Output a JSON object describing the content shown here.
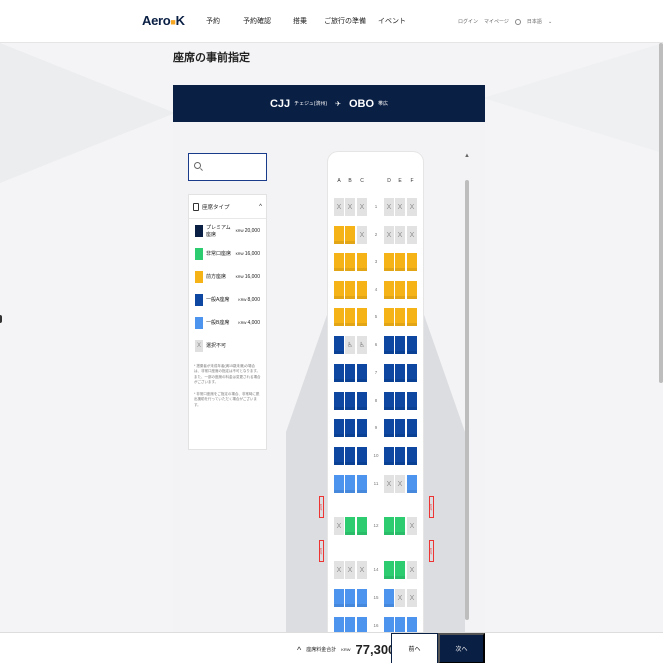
{
  "brand": {
    "logo": "Aero",
    "logo_mark": "■",
    "logo_tail": "K"
  },
  "nav": [
    "予約",
    "予約確認",
    "搭乗",
    "ご旅行の準備",
    "イベント"
  ],
  "header_right": {
    "login": "ログイン",
    "mypage": "マイページ",
    "lang": "日本語"
  },
  "page_title": "座席の事前指定",
  "route": {
    "from_code": "CJJ",
    "from_city": "チェジュ(済州)",
    "to_code": "OBO",
    "to_city": "帯広"
  },
  "search": {
    "placeholder": ""
  },
  "legend": {
    "title": "座席タイプ",
    "items": [
      {
        "label": "プレミアム座席",
        "currency": "KRW",
        "price": "20,000",
        "color": "#0a1f44"
      },
      {
        "label": "非常口座席",
        "currency": "KRW",
        "price": "16,000",
        "color": "#2ecc71"
      },
      {
        "label": "前方座席",
        "currency": "KRW",
        "price": "16,000",
        "color": "#f5b317"
      },
      {
        "label": "一般A座席",
        "currency": "KRW",
        "price": "8,000",
        "color": "#0d47a1"
      },
      {
        "label": "一般B座席",
        "currency": "KRW",
        "price": "4,000",
        "color": "#4c94ee"
      }
    ],
    "na_label": "選択不可",
    "na_mark": "X",
    "note1": "* 搭乗者が未成年者(満15歳未満)の場合は、非常口座席の指定は不可となります。また、一部の座席の料金は変更される場合がございます。",
    "note2": "* 非常口座席をご指定の場合、非常時に脱出援助を行っていただく場合がございます。"
  },
  "seatmap": {
    "columns": [
      "A",
      "B",
      "C",
      "D",
      "E",
      "F"
    ],
    "rows": [
      {
        "num": "1",
        "seats": [
          "na",
          "na",
          "na",
          "na",
          "na",
          "na"
        ]
      },
      {
        "num": "2",
        "seats": [
          "fwd",
          "fwd",
          "na",
          "na",
          "na",
          "na"
        ]
      },
      {
        "num": "3",
        "seats": [
          "fwd",
          "fwd",
          "fwd",
          "fwd",
          "fwd",
          "fwd"
        ]
      },
      {
        "num": "4",
        "seats": [
          "fwd",
          "fwd",
          "fwd",
          "fwd",
          "fwd",
          "fwd"
        ]
      },
      {
        "num": "5",
        "seats": [
          "fwd",
          "fwd",
          "fwd",
          "fwd",
          "fwd",
          "fwd"
        ]
      },
      {
        "num": "6",
        "seats": [
          "a",
          "wc",
          "wc",
          "a",
          "a",
          "a"
        ]
      },
      {
        "num": "7",
        "seats": [
          "a",
          "a",
          "a",
          "a",
          "a",
          "a"
        ]
      },
      {
        "num": "8",
        "seats": [
          "a",
          "a",
          "a",
          "a",
          "a",
          "a"
        ]
      },
      {
        "num": "9",
        "seats": [
          "a",
          "a",
          "a",
          "a",
          "a",
          "a"
        ]
      },
      {
        "num": "10",
        "seats": [
          "a",
          "a",
          "a",
          "a",
          "a",
          "a"
        ]
      },
      {
        "num": "11",
        "seats": [
          "b",
          "b",
          "b",
          "na",
          "na",
          "b"
        ]
      },
      {
        "num": "12",
        "seats": [
          "na",
          "exit",
          "exit",
          "exit",
          "exit",
          "na"
        ]
      },
      {
        "num": "14",
        "seats": [
          "na",
          "na",
          "na",
          "exit",
          "exit",
          "na"
        ]
      },
      {
        "num": "15",
        "seats": [
          "b",
          "b",
          "b",
          "b",
          "na",
          "na"
        ]
      },
      {
        "num": "16",
        "seats": [
          "b",
          "b",
          "b",
          "b",
          "b",
          "b"
        ]
      }
    ],
    "na_mark": "X",
    "wc_mark": "♿",
    "exit_label": "EXIT"
  },
  "footer": {
    "total_label": "座席料金合計",
    "currency": "KRW",
    "amount": "77,300",
    "prev": "前へ",
    "next": "次へ"
  }
}
